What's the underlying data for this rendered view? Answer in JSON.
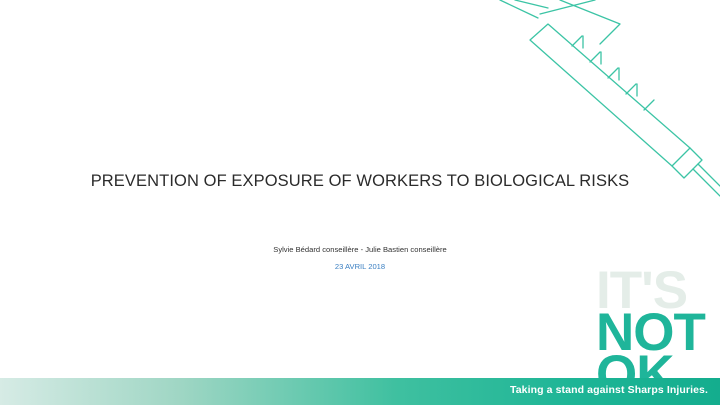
{
  "slide": {
    "title": "PREVENTION OF EXPOSURE OF WORKERS TO BIOLOGICAL RISKS",
    "authors": "Sylvie Bédard conseillère - Julie Bastien conseillère",
    "date": "23 AVRIL 2018"
  },
  "logo": {
    "line1": "IT'S",
    "line2": "NOT",
    "line3": "OK",
    "tagline": "Taking a stand against Sharps Injuries."
  },
  "colors": {
    "accent": "#1fb59a",
    "date_text": "#3a7fc2",
    "logo_light": "#e4ede8"
  },
  "icons": [
    "syringe-icon"
  ]
}
